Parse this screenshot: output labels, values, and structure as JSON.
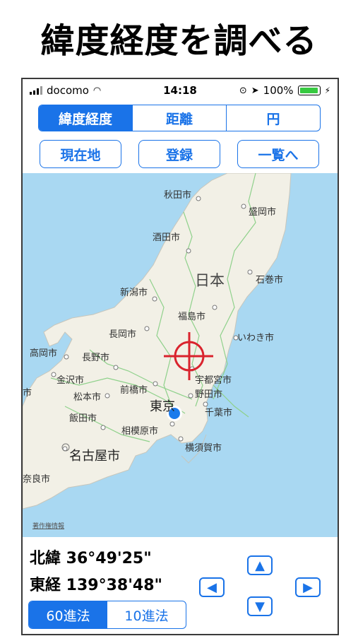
{
  "headline": "緯度経度を調べる",
  "status": {
    "carrier": "docomo",
    "time": "14:18",
    "battery": "100%"
  },
  "segments": [
    "緯度経度",
    "距離",
    "円"
  ],
  "buttons": {
    "current_location": "現在地",
    "register": "登録",
    "list": "一覧へ"
  },
  "map": {
    "country_label": "日本",
    "copyright": "著作権情報",
    "cities": [
      "秋田市",
      "盛岡市",
      "酒田市",
      "石巻市",
      "新潟市",
      "福島市",
      "長岡市",
      "いわき市",
      "高岡市",
      "長野市",
      "金沢市",
      "宇都宮市",
      "前橋市",
      "野田市",
      "松本市",
      "東京",
      "千葉市",
      "飯田市",
      "相模原市",
      "横須賀市",
      "名古屋市",
      "奈良市",
      "市"
    ]
  },
  "coords": {
    "latitude": "北緯 36°49'25\"",
    "longitude": "東経 139°38'48\""
  },
  "mode": [
    "60進法",
    "10進法"
  ],
  "arrows": {
    "up": "▲",
    "down": "▼",
    "left": "◀",
    "right": "▶"
  },
  "colors": {
    "accent": "#1a73e8",
    "sea": "#a9d8f2",
    "land": "#f2f0e6",
    "crosshair": "#d9232d"
  }
}
